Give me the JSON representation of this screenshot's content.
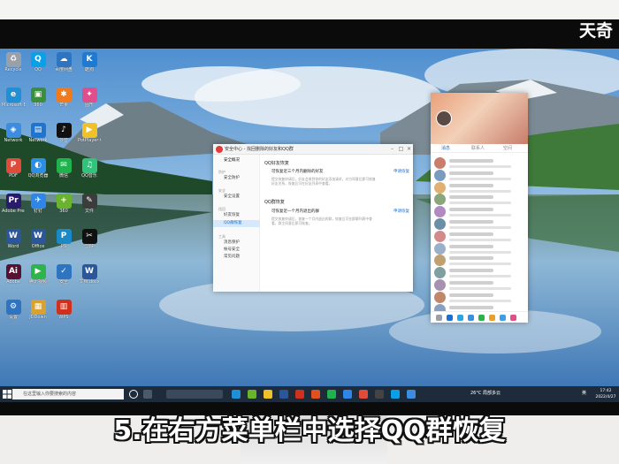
{
  "brand": "天奇",
  "caption": "5.在右方菜单栏中选择QQ群恢复",
  "desktop_icons": [
    {
      "label": "Recycle",
      "color": "#9aa0a8",
      "glyph": "♻"
    },
    {
      "label": "Microsoft Edge",
      "color": "#1f8fd6",
      "glyph": "e"
    },
    {
      "label": "Network",
      "color": "#3c8de0",
      "glyph": "◈"
    },
    {
      "label": "PDF",
      "color": "#e14b3b",
      "glyph": "P"
    },
    {
      "label": "Adobe Premiere",
      "color": "#2a1a6e",
      "glyph": "Pr"
    },
    {
      "label": "Word",
      "color": "#2b579a",
      "glyph": "W"
    },
    {
      "label": "Adobe",
      "color": "#5a1030",
      "glyph": "Ai"
    },
    {
      "label": "设置",
      "color": "#2f74c0",
      "glyph": "⚙"
    },
    {
      "label": "QQ",
      "color": "#0aa0e8",
      "glyph": "Q"
    },
    {
      "label": "360",
      "color": "#3b8e3b",
      "glyph": "▣"
    },
    {
      "label": "Network",
      "color": "#1f74cf",
      "glyph": "▤"
    },
    {
      "label": "QQ浏览器",
      "color": "#2d8ee6",
      "glyph": "◐"
    },
    {
      "label": "钉钉",
      "color": "#2d86e8",
      "glyph": "✈"
    },
    {
      "label": "Office",
      "color": "#2b579a",
      "glyph": "W"
    },
    {
      "label": "腾讯视频",
      "color": "#2db44a",
      "glyph": "▶"
    },
    {
      "label": "JDDown",
      "color": "#d9a230",
      "glyph": "▦"
    },
    {
      "label": "百度网盘",
      "color": "#2f74c0",
      "glyph": "☁"
    },
    {
      "label": "芒果",
      "color": "#f07a1c",
      "glyph": "✱"
    },
    {
      "label": "抖音",
      "color": "#111111",
      "glyph": "♪"
    },
    {
      "label": "微信",
      "color": "#20b24c",
      "glyph": "✉"
    },
    {
      "label": "360",
      "color": "#6ab42d",
      "glyph": "+"
    },
    {
      "label": "PS",
      "color": "#1a89c8",
      "glyph": "P"
    },
    {
      "label": "安全",
      "color": "#2f74c0",
      "glyph": "✓"
    },
    {
      "label": "WPS",
      "color": "#d0311c",
      "glyph": "▥"
    },
    {
      "label": "酷狗",
      "color": "#1d7bd5",
      "glyph": "K"
    },
    {
      "label": "图形",
      "color": "#e04f8c",
      "glyph": "✦"
    },
    {
      "label": "PotPlayer 64",
      "color": "#f0c229",
      "glyph": "▶"
    },
    {
      "label": "QQ音乐",
      "color": "#31c27c",
      "glyph": "♫"
    },
    {
      "label": "文件",
      "color": "#3c3c3c",
      "glyph": "✎"
    },
    {
      "label": "剪映",
      "color": "#111111",
      "glyph": "✂"
    },
    {
      "label": "文档.docx",
      "color": "#2b579a",
      "glyph": "W"
    }
  ],
  "window": {
    "title": "安全中心 - 找回删除的好友和QQ群",
    "sidebar": {
      "top_item": "安全概况",
      "groups": [
        {
          "header": "防护",
          "items": [
            "安全防护"
          ]
        },
        {
          "header": "安全",
          "items": [
            "安全设置"
          ]
        },
        {
          "header": "找回",
          "items": [
            "好友恢复",
            "QQ群恢复"
          ]
        },
        {
          "header": "工具",
          "items": [
            "消息保护",
            "帐号安全",
            "常见问题"
          ]
        }
      ],
      "selected": "QQ群恢复"
    },
    "section1": {
      "title": "QQ好友恢复",
      "subtitle": "可恢复近三个月内删除的好友",
      "link": "申请恢复",
      "desc": "提交恢复申请后，好友会收到你的好友添加请求，对方同意后即可恢复好友关系，恢复后可在好友列表中查看。"
    },
    "section2": {
      "title": "QQ群恢复",
      "subtitle": "可恢复近一个月内退出的群",
      "link": "申请恢复",
      "desc": "提交恢复申请后，恢复一个月内退出的群，恢复后可在群聊列表中查看，群主同意后即可恢复。"
    }
  },
  "qq_panel": {
    "tabs": [
      "消息",
      "联系人",
      "空间"
    ],
    "row_count": 13
  },
  "taskbar": {
    "search_placeholder": "在这里输入你要搜索的内容",
    "weather": "26°C 局部多云",
    "input_method": "英",
    "time": "17:42",
    "date": "2022/4/27"
  }
}
